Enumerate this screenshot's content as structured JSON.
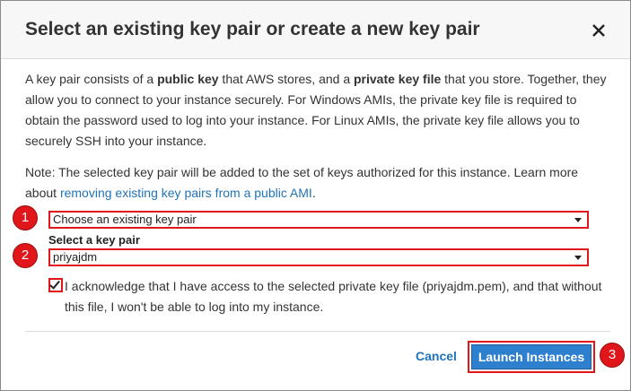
{
  "dialog": {
    "title": "Select an existing key pair or create a new key pair",
    "close_icon": "close-icon"
  },
  "intro": {
    "t1": "A key pair consists of a ",
    "b1": "public key",
    "t2": " that AWS stores, and a ",
    "b2": "private key file",
    "t3": " that you store. Together, they allow you to connect to your instance securely. For Windows AMIs, the private key file is required to obtain the password used to log into your instance. For Linux AMIs, the private key file allows you to securely SSH into your instance."
  },
  "note": {
    "text": "Note: The selected key pair will be added to the set of keys authorized for this instance. Learn more about ",
    "link": "removing existing key pairs from a public AMI",
    "after": "."
  },
  "form": {
    "mode_select_value": "Choose an existing key pair",
    "key_pair_label": "Select a key pair",
    "key_pair_value": "priyajdm",
    "acknowledge_checked": true,
    "acknowledge_text": "I acknowledge that I have access to the selected private key file (priyajdm.pem), and that without this file, I won't be able to log into my instance."
  },
  "footer": {
    "cancel_label": "Cancel",
    "launch_label": "Launch Instances"
  },
  "annotations": {
    "badge_1": "1",
    "badge_2": "2",
    "badge_3": "3",
    "highlight_color": "#e0161a"
  },
  "colors": {
    "link": "#2074b8",
    "primary_button": "#2f7fcf",
    "header_bg": "#f7f7f7"
  }
}
